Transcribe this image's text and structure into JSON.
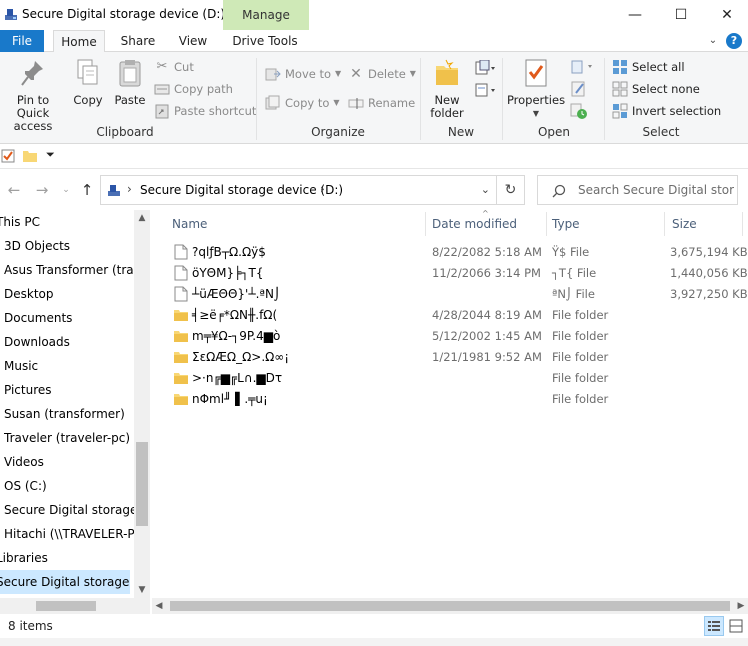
{
  "window": {
    "title": "Secure Digital storage device (D:)",
    "context_tab": "Manage",
    "controls": [
      "—",
      "☐",
      "✕"
    ]
  },
  "ribbon_tabs": [
    "File",
    "Home",
    "Share",
    "View",
    "Drive Tools"
  ],
  "ribbon": {
    "clipboard": {
      "pin_label": "Pin to Quick access",
      "copy_label": "Copy",
      "paste_label": "Paste",
      "cut_label": "Cut",
      "copy_path_label": "Copy path",
      "paste_shortcut_label": "Paste shortcut",
      "group_label": "Clipboard"
    },
    "organize": {
      "move_to_label": "Move to",
      "copy_to_label": "Copy to",
      "delete_label": "Delete",
      "rename_label": "Rename",
      "group_label": "Organize"
    },
    "new": {
      "new_folder_label": "New folder",
      "group_label": "New"
    },
    "open": {
      "properties_label": "Properties",
      "group_label": "Open"
    },
    "select": {
      "select_all_label": "Select all",
      "select_none_label": "Select none",
      "invert_label": "Invert selection",
      "group_label": "Select"
    }
  },
  "address": {
    "path": "Secure Digital storage device (D:)",
    "search_placeholder": "Search Secure Digital storag..."
  },
  "nav_pane": {
    "items": [
      {
        "label": "This PC",
        "indent": 0,
        "selected": false
      },
      {
        "label": "3D Objects",
        "indent": 1,
        "selected": false
      },
      {
        "label": "Asus Transformer (transf",
        "indent": 1,
        "selected": false
      },
      {
        "label": "Desktop",
        "indent": 1,
        "selected": false
      },
      {
        "label": "Documents",
        "indent": 1,
        "selected": false
      },
      {
        "label": "Downloads",
        "indent": 1,
        "selected": false
      },
      {
        "label": "Music",
        "indent": 1,
        "selected": false
      },
      {
        "label": "Pictures",
        "indent": 1,
        "selected": false
      },
      {
        "label": "Susan (transformer)",
        "indent": 1,
        "selected": false
      },
      {
        "label": "Traveler (traveler-pc)",
        "indent": 1,
        "selected": false
      },
      {
        "label": "Videos",
        "indent": 1,
        "selected": false
      },
      {
        "label": "OS (C:)",
        "indent": 1,
        "selected": false
      },
      {
        "label": "Secure Digital storage de",
        "indent": 1,
        "selected": false
      },
      {
        "label": "Hitachi (\\\\TRAVELER-PC",
        "indent": 1,
        "selected": false
      },
      {
        "label": "Libraries",
        "indent": 0,
        "selected": false
      },
      {
        "label": "Secure Digital storage dev",
        "indent": 0,
        "selected": true
      }
    ]
  },
  "columns": {
    "name": "Name",
    "date": "Date modified",
    "type": "Type",
    "size": "Size"
  },
  "files": [
    {
      "name": "?qlƒB┬Ω.Ωÿ$",
      "date": "8/22/2082 5:18 AM",
      "type": "Ÿ$ File",
      "size": "3,675,194 KB",
      "kind": "file"
    },
    {
      "name": "öYΘM}╞┐T{",
      "date": "11/2/2066 3:14 PM",
      "type": "┐T{ File",
      "size": "1,440,056 KB",
      "kind": "file"
    },
    {
      "name": "┴üÆΘΘ}'┴.ªN⌡",
      "date": "",
      "type": "ªN⌡ File",
      "size": "3,927,250 KB",
      "kind": "file"
    },
    {
      "name": "╡≥ë╒*ΩN╫.fΩ(",
      "date": "4/28/2044 8:19 AM",
      "type": "File folder",
      "size": "",
      "kind": "folder"
    },
    {
      "name": "m╤¥Ω-┐9P.4▆ò",
      "date": "5/12/2002 1:45 AM",
      "type": "File folder",
      "size": "",
      "kind": "folder"
    },
    {
      "name": "ΣεΩÆΩ_Ω>.Ω∞¡",
      "date": "1/21/1981 9:52 AM",
      "type": "File folder",
      "size": "",
      "kind": "folder"
    },
    {
      "name": ">·n╔▆╔L∩.▆Dτ",
      "date": "",
      "type": "File folder",
      "size": "",
      "kind": "folder"
    },
    {
      "name": "nΦml╜ ▌.╤u¡",
      "date": "",
      "type": "File folder",
      "size": "",
      "kind": "folder"
    }
  ],
  "status": {
    "item_count": "8 items"
  },
  "colors": {
    "file_tab": "#1979ca",
    "manage_tab": "#cfe9b7",
    "selection": "#cce8ff",
    "folder": "#f8d775"
  }
}
